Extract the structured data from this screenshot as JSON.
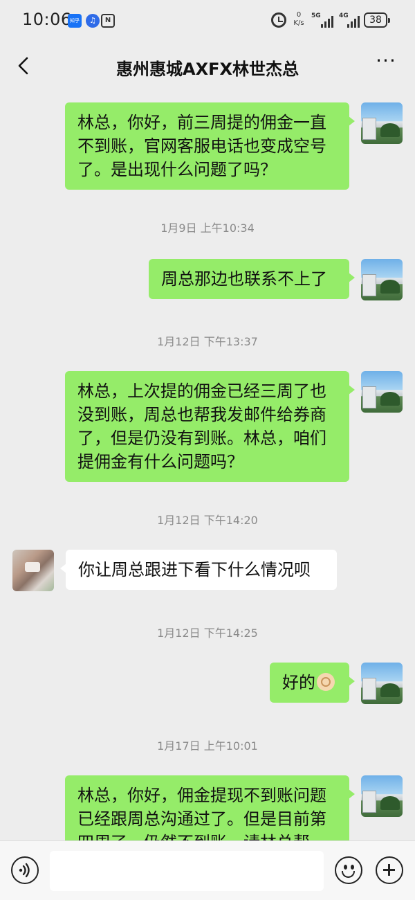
{
  "status_bar": {
    "time": "10:06",
    "app_icons": [
      "zhihu-icon",
      "music-icon",
      "nfc-icon"
    ],
    "zhihu_label": "知乎",
    "network_speed_value": "0",
    "network_speed_unit": "K/s",
    "signal_1_label": "5G",
    "signal_2_label": "4G",
    "battery": "38"
  },
  "header": {
    "title": "惠州惠城AXFX林世杰总",
    "more_label": "···"
  },
  "messages": [
    {
      "side": "out",
      "text": "林总，你好，前三周提的佣金一直不到账，官网客服电话也变成空号了。是出现什么问题了吗？"
    },
    {
      "type": "time",
      "text": "1月9日 上午10:34"
    },
    {
      "side": "out",
      "text": "周总那边也联系不上了"
    },
    {
      "type": "time",
      "text": "1月12日 下午13:37"
    },
    {
      "side": "out",
      "text": "林总，上次提的佣金已经三周了也没到账，周总也帮我发邮件给券商了，但是仍没有到账。林总，咱们提佣金有什么问题吗？"
    },
    {
      "type": "time",
      "text": "1月12日 下午14:20"
    },
    {
      "side": "in",
      "text": "你让周总跟进下看下什么情况呗"
    },
    {
      "type": "time",
      "text": "1月12日 下午14:25"
    },
    {
      "side": "out",
      "text": "好的",
      "emoji": "ok-hand-emoji"
    },
    {
      "type": "time",
      "text": "1月17日 上午10:01"
    },
    {
      "side": "out",
      "text": "林总，你好，佣金提现不到账问题已经跟周总沟通过了。但是目前第四周了，仍然不到账，请林总帮"
    }
  ],
  "input_bar": {
    "placeholder": "",
    "value": ""
  },
  "colors": {
    "background": "#ededed",
    "outgoing_bubble": "#95ec69",
    "incoming_bubble": "#ffffff",
    "timestamp_text": "#8a8a8a"
  }
}
